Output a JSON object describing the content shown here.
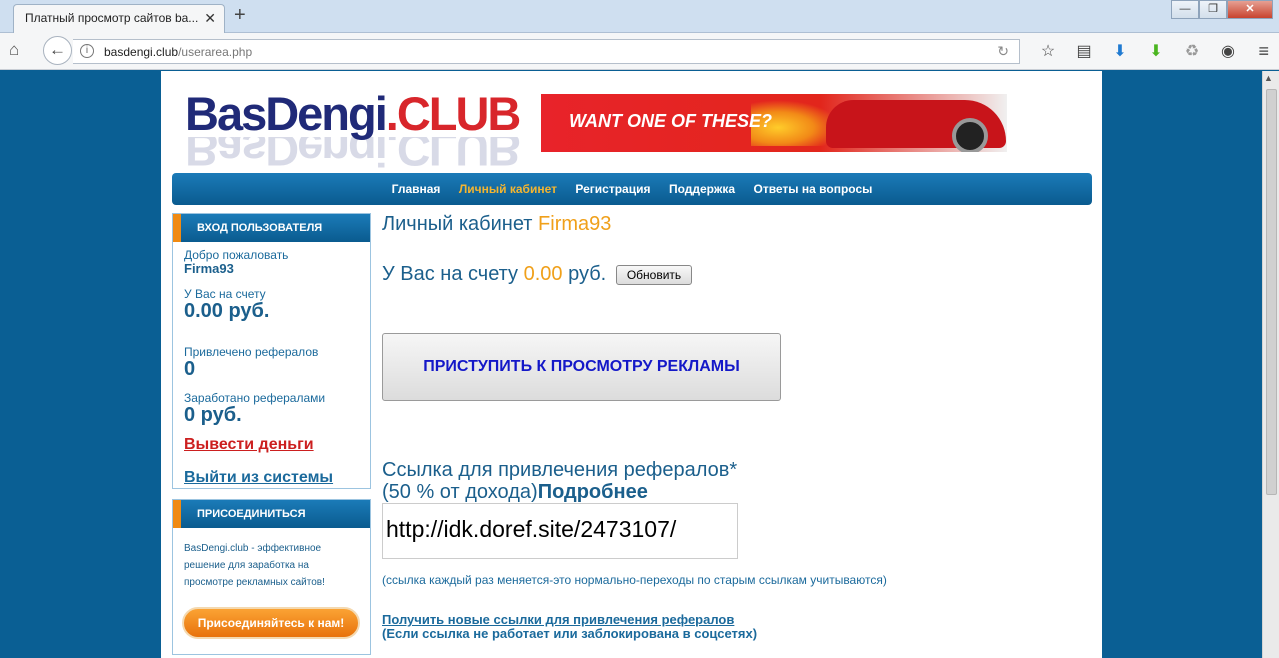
{
  "browser": {
    "tab_title": "Платный просмотр сайтов ba...",
    "tab_close": "✕",
    "new_tab": "+",
    "url_domain": "basdengi.club",
    "url_path": "/userarea.php",
    "win_minimize": "—",
    "win_maximize": "❐",
    "win_close": "✕"
  },
  "site": {
    "logo_main": "BasDengi",
    "logo_club": ".CLUB",
    "banner_text": "WANT ONE OF THESE?"
  },
  "menu": {
    "items": [
      "Главная",
      "Личный кабинет",
      "Регистрация",
      "Поддержка",
      "Ответы на вопросы"
    ]
  },
  "sidebar": {
    "login_header": "ВХОД ПОЛЬЗОВАТЕЛЯ",
    "welcome": "Добро пожаловать",
    "username": "Firma93",
    "balance_label": "У Вас на счету",
    "balance_value": "0.00 руб.",
    "referrals_label": "Привлечено рефералов",
    "referrals_value": "0",
    "earned_label": "Заработано рефералами",
    "earned_value": "0 руб.",
    "withdraw": "Вывести деньги",
    "logout": "Выйти из системы",
    "join_header": "ПРИСОЕДИНИТЬСЯ",
    "join_text": "BasDengi.club - эффективное решение для заработка на просмотре рекламных сайтов!",
    "join_button": "Присоединяйтесь к нам!"
  },
  "main": {
    "title_prefix": "Личный кабинет ",
    "title_user": "Firma93",
    "balance_prefix": "У Вас на счету ",
    "balance_amount": "0.00",
    "balance_suffix": " руб.",
    "refresh_button": "Обновить",
    "ads_button": "ПРИСТУПИТЬ К ПРОСМОТРУ РЕКЛАМЫ",
    "ref_title": "Ссылка для привлечения рефералов*",
    "ref_percent": "(50 % от дохода)",
    "ref_more": "Подробнее",
    "ref_link": "http://idk.doref.site/2473107/",
    "ref_note": "(ссылка каждый раз меняется-это нормально-переходы по старым ссылкам учитываются)",
    "ref_new_link": "Получить новые ссылки для привлечения рефералов",
    "ref_new_note": "(Если ссылка не работает или заблокирована в соцсетях)"
  }
}
